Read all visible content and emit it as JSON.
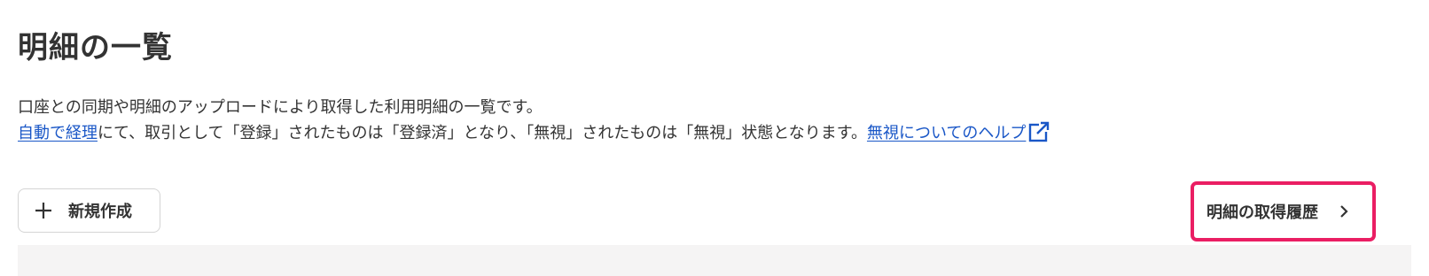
{
  "header": {
    "title": "明細の一覧"
  },
  "description": {
    "line1": "口座との同期や明細のアップロードにより取得した利用明細の一覧です。",
    "auto_link": "自動で経理",
    "line2_text": "にて、取引として「登録」されたものは「登録済」となり、「無視」されたものは「無視」状態となります。",
    "help_link": "無視についてのヘルプ",
    "help_link_icon": "external-link-icon"
  },
  "toolbar": {
    "new_button_label": "新規作成",
    "new_button_icon": "plus-icon",
    "history_button_label": "明細の取得履歴",
    "history_button_icon": "chevron-right-icon",
    "highlight_color": "#ea1e63"
  },
  "colors": {
    "link": "#1a57c7",
    "text": "#333333",
    "content_background": "#f5f4f4"
  }
}
